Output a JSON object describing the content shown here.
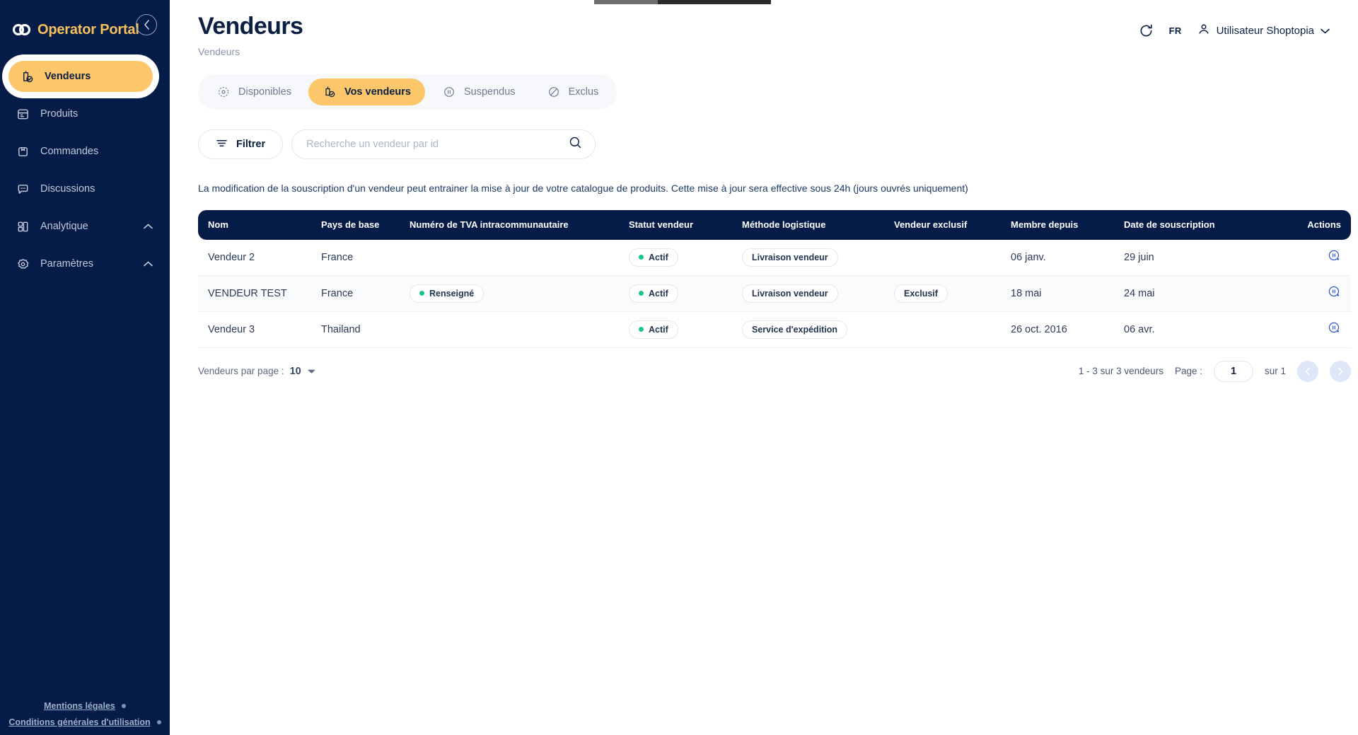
{
  "brand": {
    "name": "Operator Portal",
    "logo_icon": "infinity-logo-icon",
    "collapse_icon": "chevron-left-icon"
  },
  "sidebar": {
    "items": [
      {
        "label": "Vendeurs",
        "icon": "vendor-icon",
        "active": true,
        "expandable": false
      },
      {
        "label": "Produits",
        "icon": "products-icon",
        "active": false,
        "expandable": false
      },
      {
        "label": "Commandes",
        "icon": "orders-icon",
        "active": false,
        "expandable": false
      },
      {
        "label": "Discussions",
        "icon": "chat-icon",
        "active": false,
        "expandable": false
      },
      {
        "label": "Analytique",
        "icon": "analytics-icon",
        "active": false,
        "expandable": true
      },
      {
        "label": "Paramètres",
        "icon": "settings-icon",
        "active": false,
        "expandable": true
      }
    ],
    "footer_links": [
      {
        "label": "Mentions légales"
      },
      {
        "label": "Conditions générales d'utilisation"
      }
    ]
  },
  "header": {
    "title": "Vendeurs",
    "breadcrumb": "Vendeurs",
    "refresh_icon": "refresh-icon",
    "language": "FR",
    "user_icon": "user-icon",
    "user_name": "Utilisateur Shoptopia",
    "chevron_icon": "chevron-down-icon"
  },
  "tabs": [
    {
      "label": "Disponibles",
      "icon": "compass-icon",
      "active": false
    },
    {
      "label": "Vos vendeurs",
      "icon": "vendor-check-icon",
      "active": true
    },
    {
      "label": "Suspendus",
      "icon": "pause-circle-icon",
      "active": false
    },
    {
      "label": "Exclus",
      "icon": "ban-icon",
      "active": false
    }
  ],
  "toolbar": {
    "filter_label": "Filtrer",
    "filter_icon": "filter-icon",
    "search_placeholder": "Recherche un vendeur par id",
    "search_value": "",
    "search_icon": "search-icon"
  },
  "notice": "La modification de la souscription d'un vendeur peut entrainer la mise à jour de votre catalogue de produits. Cette mise à jour sera effective sous 24h (jours ouvrés uniquement)",
  "table": {
    "columns": [
      "Nom",
      "Pays de base",
      "Numéro de TVA intracommunautaire",
      "Statut vendeur",
      "Méthode logistique",
      "Vendeur exclusif",
      "Membre depuis",
      "Date de souscription",
      "Actions"
    ],
    "rows": [
      {
        "nom": "Vendeur 2",
        "pays": "France",
        "tva": "",
        "statut": "Actif",
        "methode": "Livraison vendeur",
        "exclusif": "",
        "membre": "06 janv.",
        "souscription": "29 juin",
        "action_icon": "pause-circle-icon"
      },
      {
        "nom": "VENDEUR TEST",
        "pays": "France",
        "tva": "Renseigné",
        "statut": "Actif",
        "methode": "Livraison vendeur",
        "exclusif": "Exclusif",
        "membre": "18 mai",
        "souscription": "24 mai",
        "action_icon": "pause-circle-icon"
      },
      {
        "nom": "Vendeur 3",
        "pays": "Thailand",
        "tva": "",
        "statut": "Actif",
        "methode": "Service d'expédition",
        "exclusif": "",
        "membre": "26 oct. 2016",
        "souscription": "06 avr.",
        "action_icon": "pause-circle-icon"
      }
    ]
  },
  "pagination": {
    "per_page_label": "Vendeurs par page :",
    "per_page_value": "10",
    "per_page_chevron": "chevron-down-icon",
    "range_text": "1 - 3 sur 3 vendeurs",
    "page_label": "Page :",
    "page_value": "1",
    "of_text": "sur 1",
    "prev_icon": "chevron-left-icon",
    "next_icon": "chevron-right-icon"
  },
  "colors": {
    "navy": "#041c47",
    "accent_yellow": "#fbc76a",
    "brand_yellow": "#f7c05a",
    "status_green": "#18c48f"
  }
}
